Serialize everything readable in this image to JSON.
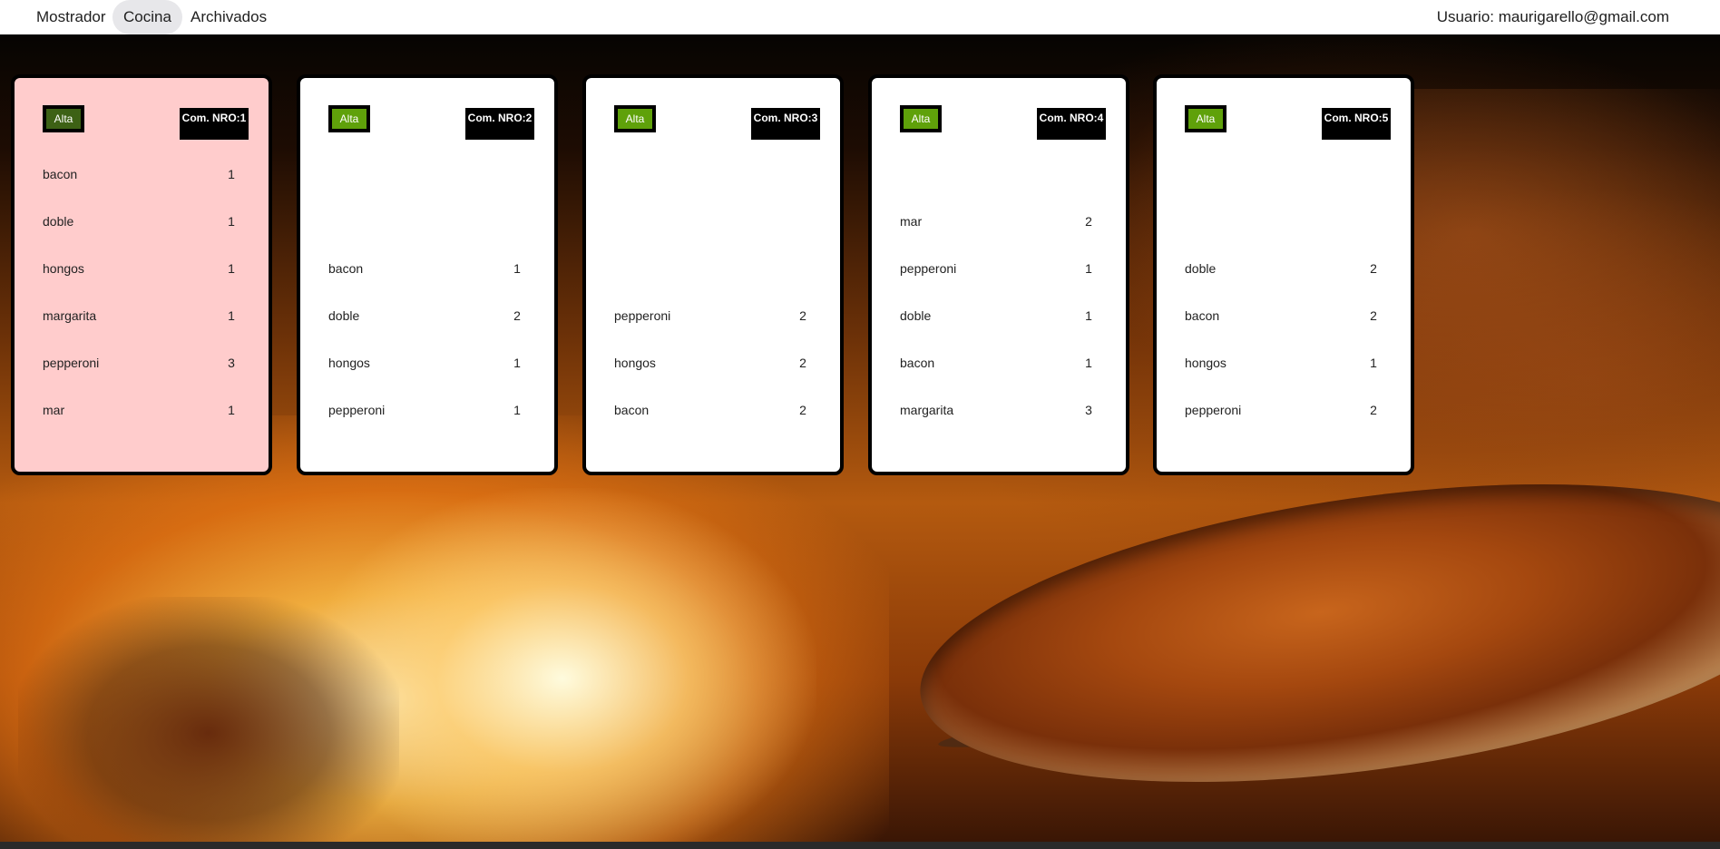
{
  "nav": {
    "items": [
      {
        "label": "Mostrador"
      },
      {
        "label": "Cocina",
        "active": true
      },
      {
        "label": "Archivados"
      }
    ],
    "user_label": "Usuario: maurigarello@gmail.com"
  },
  "colors": {
    "alta_button": "#5fa10a",
    "alta_button_highlight": "#3d6115",
    "highlight_card": "#ffcccc",
    "order_badge": "#000000"
  },
  "orders": [
    {
      "alta_label": "Alta",
      "number_label": "Com. NRO:1",
      "highlighted": true,
      "items": [
        {
          "name": "bacon",
          "qty": "1"
        },
        {
          "name": "doble",
          "qty": "1"
        },
        {
          "name": "hongos",
          "qty": "1"
        },
        {
          "name": "margarita",
          "qty": "1"
        },
        {
          "name": "pepperoni",
          "qty": "3"
        },
        {
          "name": "mar",
          "qty": "1"
        }
      ]
    },
    {
      "alta_label": "Alta",
      "number_label": "Com. NRO:2",
      "highlighted": false,
      "items": [
        {
          "name": "bacon",
          "qty": "1"
        },
        {
          "name": "doble",
          "qty": "2"
        },
        {
          "name": "hongos",
          "qty": "1"
        },
        {
          "name": "pepperoni",
          "qty": "1"
        }
      ]
    },
    {
      "alta_label": "Alta",
      "number_label": "Com. NRO:3",
      "highlighted": false,
      "items": [
        {
          "name": "pepperoni",
          "qty": "2"
        },
        {
          "name": "hongos",
          "qty": "2"
        },
        {
          "name": "bacon",
          "qty": "2"
        }
      ]
    },
    {
      "alta_label": "Alta",
      "number_label": "Com. NRO:4",
      "highlighted": false,
      "items": [
        {
          "name": "mar",
          "qty": "2"
        },
        {
          "name": "pepperoni",
          "qty": "1"
        },
        {
          "name": "doble",
          "qty": "1"
        },
        {
          "name": "bacon",
          "qty": "1"
        },
        {
          "name": "margarita",
          "qty": "3"
        }
      ]
    },
    {
      "alta_label": "Alta",
      "number_label": "Com. NRO:5",
      "highlighted": false,
      "items": [
        {
          "name": "doble",
          "qty": "2"
        },
        {
          "name": "bacon",
          "qty": "2"
        },
        {
          "name": "hongos",
          "qty": "1"
        },
        {
          "name": "pepperoni",
          "qty": "2"
        }
      ]
    }
  ]
}
